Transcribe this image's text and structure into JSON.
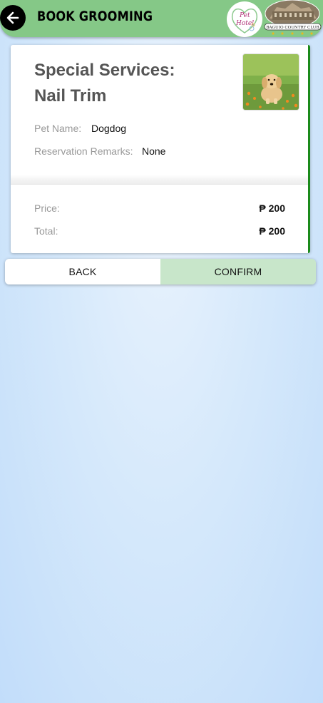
{
  "header": {
    "title": "BOOK GROOMING",
    "back_icon": "arrow-left-icon",
    "logo_pet_text": "Pet Hotel",
    "logo_club_text": "BAGUIO COUNTRY CLUB"
  },
  "booking": {
    "service_label": "Special Services:",
    "service_name": "Nail Trim",
    "pet_name_label": "Pet Name:",
    "pet_name_value": "Dogdog",
    "remarks_label": "Reservation Remarks:",
    "remarks_value": "None",
    "price_label": "Price:",
    "price_value": "₱ 200",
    "total_label": "Total:",
    "total_value": "₱ 200"
  },
  "actions": {
    "back_label": "BACK",
    "confirm_label": "CONFIRM"
  },
  "colors": {
    "header": "#85c887",
    "accent_border": "#1a8a1a",
    "confirm_bg": "#c8e6ca"
  }
}
